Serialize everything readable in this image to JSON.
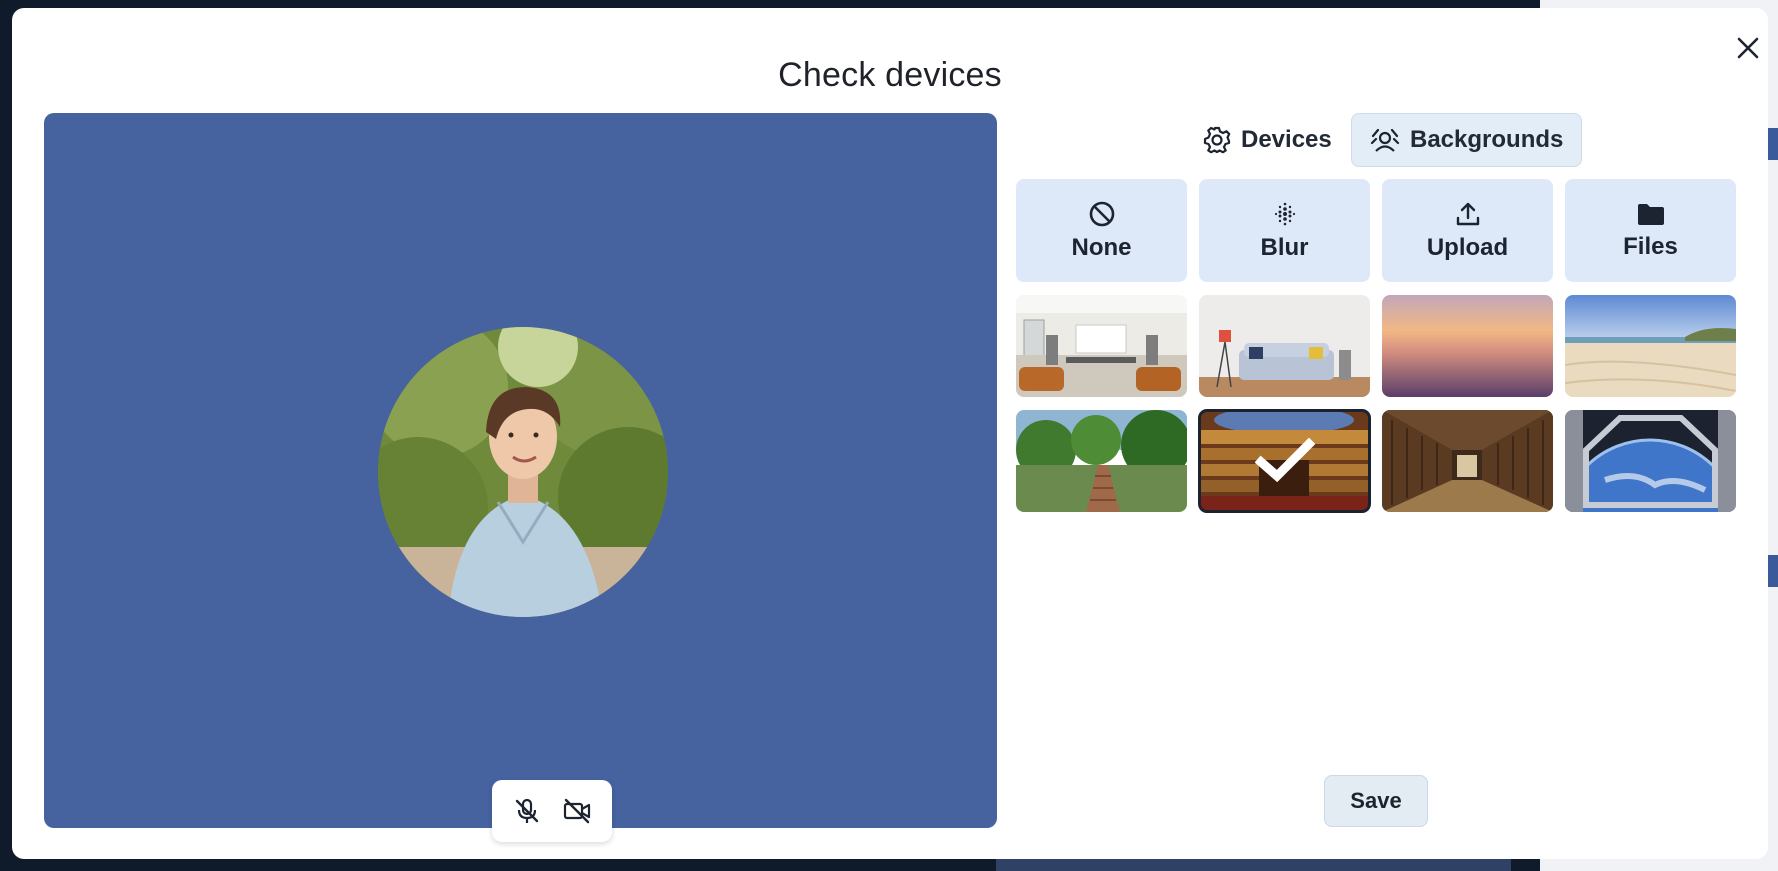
{
  "modal": {
    "title": "Check devices",
    "save_label": "Save"
  },
  "tabs": [
    {
      "label": "Devices",
      "icon": "gear-icon",
      "active": false
    },
    {
      "label": "Backgrounds",
      "icon": "background-person-icon",
      "active": true
    }
  ],
  "options": [
    {
      "label": "None",
      "icon": "no-entry-icon"
    },
    {
      "label": "Blur",
      "icon": "blur-dots-icon"
    },
    {
      "label": "Upload",
      "icon": "upload-icon"
    },
    {
      "label": "Files",
      "icon": "folder-icon"
    }
  ],
  "backgrounds": [
    {
      "name": "office",
      "selected": false
    },
    {
      "name": "sofa-room",
      "selected": false
    },
    {
      "name": "sunset-gradient",
      "selected": false
    },
    {
      "name": "beach",
      "selected": false
    },
    {
      "name": "jungle-bridge",
      "selected": false
    },
    {
      "name": "opera-theater",
      "selected": true
    },
    {
      "name": "library",
      "selected": false
    },
    {
      "name": "space-station",
      "selected": false
    }
  ],
  "colors": {
    "preview_bg": "#4663a0",
    "tile_bg": "#dde9f8",
    "active_tab_bg": "#e3edf7"
  }
}
